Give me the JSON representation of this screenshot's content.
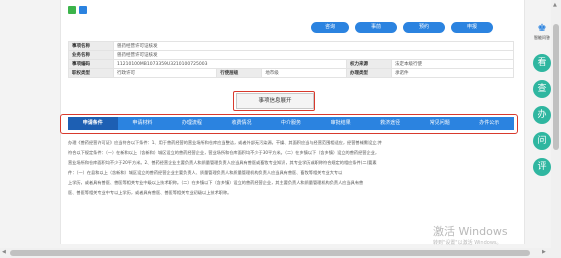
{
  "colors": {
    "accent": "#2b83e0",
    "tab_active": "#1d5fb3",
    "highlight": "#d83a2d",
    "side_button": "#2fb6a0",
    "icon_green": "#3cb44b",
    "icon_blue": "#2b83e0"
  },
  "top_buttons": [
    "咨询",
    "事前",
    "预约",
    "申报"
  ],
  "info_rows": [
    [
      "事项名称",
      "兽药经营许可证核发",
      "",
      "",
      "",
      ""
    ],
    [
      "业务名称",
      "兽药经营许可证核发",
      "",
      "",
      "",
      ""
    ],
    [
      "事项编码",
      "11210100MB1073359U3210100725003",
      "",
      "",
      "权力来源",
      "法定本级行使"
    ],
    [
      "职权类型",
      "行政许可",
      "行使层级",
      "地市级",
      "办理类型",
      "承诺件"
    ]
  ],
  "expand_label": "事项信息展开",
  "tabs": [
    "申请条件",
    "申请材料",
    "办理流程",
    "收费情况",
    "中介服务",
    "审批结果",
    "救济途径",
    "常见问题",
    "办件公示"
  ],
  "description": [
    "办理《兽药经营许可证》应当符合以下条件：1、用于兽药经营的营业场所和仓库应当整洁，或者外部无污染源。干燥、其面积应当与经营范围相适应，经营兽械需设立;并",
    "符合以下规定条件：（一）在新和以上（含新和）城区设立的兽药经营企业，营业场所和仓库面积均不少于30平方米。（二）在乡镇以下（含乡镇）设立的兽药经营企业，",
    "营业场所和仓库面积均不少于20平方米。2、兽药经营企业主要负责人和质量管理负责人应当具有兽医或畜牧专业知识，其专业学历或职称符合规定的相应条件(二)要素",
    "件：（一）在县和以上（含新和）城区设立的兽药经营企业主要负责人、质量管理负责人和质量管理机构负责人应当具有兽医、畜牧等相关专业大专以",
    "上学历，或者具有兽医、兽医等相关专业中级以上技术职称。（二）在乡镇以下（含乡镇）设立的兽药经营企业，其主要负责人和质量管理机构负责人应当具有兽",
    "医、兽医等相关专业中专以上学历，或者具有兽医、兽医等相关专业初级以上技术职称。"
  ],
  "sidebar": {
    "top_label": "智能问答",
    "buttons": [
      "看",
      "查",
      "办",
      "问",
      "评"
    ]
  },
  "watermark": {
    "line1": "激活 Windows",
    "line2": "转到\"设置\"以激活 Windows。"
  }
}
